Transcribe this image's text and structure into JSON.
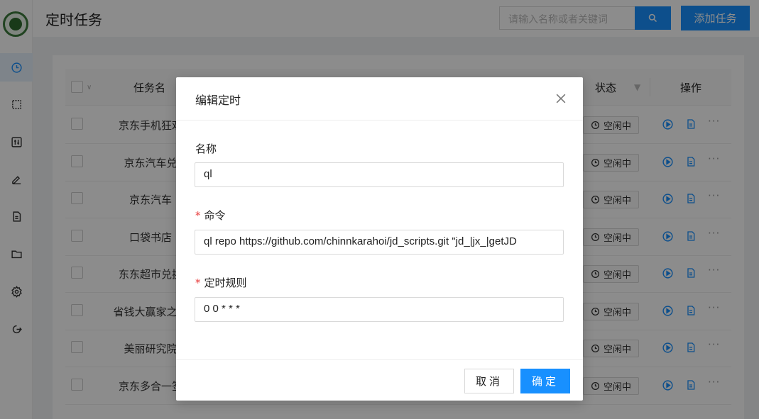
{
  "app": {
    "accent_color": "#1890ff"
  },
  "header": {
    "title": "定时任务",
    "search_placeholder": "请输入名称或者关键词",
    "add_button": "添加任务"
  },
  "sidebar": {
    "items": [
      {
        "icon": "clock-icon",
        "active": true
      },
      {
        "icon": "crop-icon"
      },
      {
        "icon": "sliders-icon"
      },
      {
        "icon": "edit-icon"
      },
      {
        "icon": "file-icon"
      },
      {
        "icon": "folder-icon"
      },
      {
        "icon": "gear-icon"
      },
      {
        "icon": "logout-icon"
      }
    ]
  },
  "table": {
    "columns": {
      "name": "任务名",
      "status": "状态",
      "actions": "操作"
    },
    "rows": [
      {
        "name": "京东手机狂欢",
        "status": "空闲中"
      },
      {
        "name": "京东汽车兑",
        "status": "空闲中"
      },
      {
        "name": "京东汽车",
        "status": "空闲中"
      },
      {
        "name": "口袋书店",
        "status": "空闲中"
      },
      {
        "name": "东东超市兑换",
        "status": "空闲中"
      },
      {
        "name": "省钱大赢家之翻",
        "status": "空闲中"
      },
      {
        "name": "美丽研究院",
        "status": "空闲中"
      },
      {
        "name": "京东多合一签",
        "status": "空闲中"
      }
    ]
  },
  "modal": {
    "title": "编辑定时",
    "name_label": "名称",
    "name_value": "ql",
    "command_label": "命令",
    "command_value": "ql repo https://github.com/chinnkarahoi/jd_scripts.git \"jd_|jx_|getJD",
    "schedule_label": "定时规则",
    "schedule_value": "0 0 * * *",
    "required_mark": "*",
    "cancel_button": "取消",
    "ok_button": "确定"
  }
}
